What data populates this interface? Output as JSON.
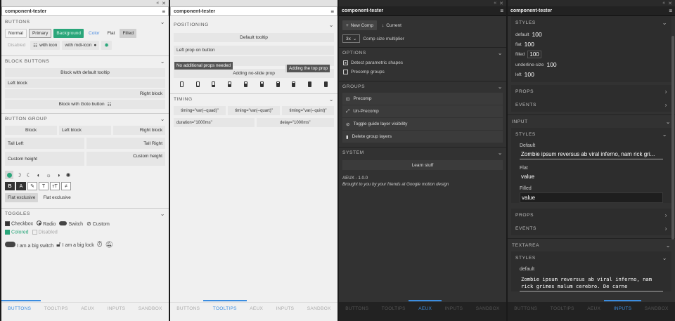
{
  "window_controls": {
    "collapse": "«",
    "close": "✕"
  },
  "menu_glyph": "≡",
  "tabs": [
    "BUTTONS",
    "TOOLTIPS",
    "AEUX",
    "INPUTS",
    "SANDBOX"
  ],
  "panel1": {
    "title": "component-tester",
    "buttons": {
      "heading": "BUTTONS",
      "row1": [
        "Normal",
        "Primary",
        "Background",
        "Color",
        "Flat",
        "Filled"
      ],
      "row2": {
        "disabled": "Disabled",
        "with_icon": "with icon",
        "with_mdi": "with mdi-icon"
      }
    },
    "block_buttons": {
      "heading": "BLOCK BUTTONS",
      "default_tooltip": "Block with default tooltip",
      "left": "Left block",
      "right": "Right block",
      "goto": "Block with Goto button"
    },
    "button_group": {
      "heading": "BUTTON GROUP",
      "row1": [
        "Block",
        "Left block",
        "Right block"
      ],
      "tall_left": "Tall Left",
      "tall_right": "Tall Right",
      "custom_height_left": "Custom height",
      "custom_height_right": "Custom height",
      "format_bold": "B",
      "format_a": "A",
      "flat_exclusive_1": "Flat exclusive",
      "flat_exclusive_2": "Flat exclusive"
    },
    "toggles": {
      "heading": "TOGGLES",
      "checkbox": "Checkbox",
      "radio": "Radio",
      "switch": "Switch",
      "custom": "Custom",
      "colored": "Colored",
      "disabled": "Disabled",
      "big_switch": "I am a big switch",
      "big_lock": "I am a big lock"
    },
    "active_tab": "BUTTONS"
  },
  "panel2": {
    "title": "component-tester",
    "positioning": {
      "heading": "POSITIONING",
      "default_tooltip": "Default tooltip",
      "left_prop": "Left prop on button",
      "no_props_tip": "No additional props needed",
      "top_prop_tip": "Adding the top prop",
      "no_slide": "Adding no-slide prop"
    },
    "timing": {
      "heading": "TIMING",
      "row1": [
        "timing=\"var(--quad)\"",
        "timing=\"var(--quart)\"",
        "timing=\"var(--quint)\""
      ],
      "duration": "duration=\"1000ms\"",
      "delay": "delay=\"1000ms\""
    },
    "active_tab": "TOOLTIPS"
  },
  "panel3": {
    "title": "component-tester",
    "new_comp": "New Comp",
    "current": "Current",
    "multiplier_value": "3x",
    "multiplier_label": "Comp size multiplier",
    "options": {
      "heading": "OPTIONS",
      "detect": "Detect parametric shapes",
      "precomp_groups": "Precomp groups"
    },
    "groups": {
      "heading": "GROUPS",
      "items": [
        "Precomp",
        "Un-Precomp",
        "Toggle guide layer visibility",
        "Delete group layers"
      ]
    },
    "system": {
      "heading": "SYSTEM",
      "learn": "Learn stuff",
      "version": "AEUX - 1.0.0",
      "credit": "Brought to you by your friends at Google motion design"
    },
    "active_tab": "AEUX"
  },
  "panel4": {
    "title": "component-tester",
    "styles1": {
      "heading": "STYLES",
      "rows": [
        {
          "k": "default",
          "v": "100"
        },
        {
          "k": "flat",
          "v": "100"
        },
        {
          "k": "filled",
          "v": "100"
        },
        {
          "k": "underline-size",
          "v": "100"
        },
        {
          "k": "left",
          "v": "100"
        }
      ]
    },
    "props": "PROPS",
    "events": "EVENTS",
    "input": {
      "heading": "INPUT",
      "styles": "STYLES",
      "default_label": "Default",
      "default_value": "Zombie ipsum reversus ab viral inferno, nam rick gri...",
      "flat_label": "Flat",
      "flat_value": "value",
      "filled_label": "Filled",
      "filled_value": "value",
      "props": "PROPS",
      "events": "EVENTS"
    },
    "textarea": {
      "heading": "TEXTAREA",
      "styles": "STYLES",
      "default_label": "default",
      "value_line1": "Zombie ipsum reversus ab viral inferno, nam",
      "value_line2": "rick grimes malum cerebro. De carne"
    },
    "active_tab": "INPUTS"
  },
  "colors": {
    "accent": "#3b8de0",
    "green": "#2aa67a",
    "dark_bg": "#323232",
    "light_bg": "#f0f0f0"
  }
}
